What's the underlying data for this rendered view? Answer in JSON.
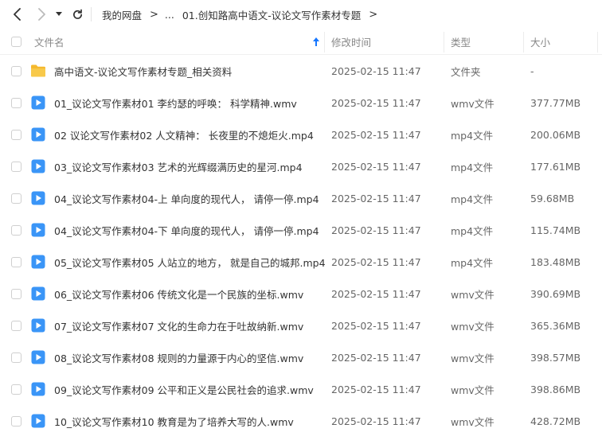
{
  "nav": {
    "back_icon": "chevron-left-icon",
    "forward_icon": "chevron-right-icon",
    "history_icon": "caret-down-icon",
    "refresh_icon": "refresh-icon"
  },
  "breadcrumb": {
    "root": "我的网盘",
    "ellipsis": "...",
    "current": "01.创知路高中语文-议论文写作素材专题"
  },
  "columns": {
    "name": "文件名",
    "modified": "修改时间",
    "type": "类型",
    "size": "大小",
    "sort_icon": "sort-up-arrow-icon"
  },
  "colors": {
    "accent": "#1677ff",
    "folder": "#f5b92e",
    "video": "#3a95f7"
  },
  "files": [
    {
      "name": "高中语文-议论文写作素材专题_相关资料",
      "modified": "2025-02-15 11:47",
      "type": "文件夹",
      "size": "-",
      "icon": "folder-icon"
    },
    {
      "name": "01_议论文写作素材01 李约瑟的呼唤： 科学精神.wmv",
      "modified": "2025-02-15 11:47",
      "type": "wmv文件",
      "size": "377.77MB",
      "icon": "video-file-icon"
    },
    {
      "name": "02 议论文写作素材02 人文精神： 长夜里的不熄炬火.mp4",
      "modified": "2025-02-15 11:47",
      "type": "mp4文件",
      "size": "200.06MB",
      "icon": "video-file-icon"
    },
    {
      "name": "03_议论文写作素材03 艺术的光辉缀满历史的星河.mp4",
      "modified": "2025-02-15 11:47",
      "type": "mp4文件",
      "size": "177.61MB",
      "icon": "video-file-icon"
    },
    {
      "name": "04_议论文写作素材04-上 单向度的现代人， 请停一停.mp4",
      "modified": "2025-02-15 11:47",
      "type": "mp4文件",
      "size": "59.68MB",
      "icon": "video-file-icon"
    },
    {
      "name": "04_议论文写作素材04-下 单向度的现代人， 请停一停.mp4",
      "modified": "2025-02-15 11:47",
      "type": "mp4文件",
      "size": "115.74MB",
      "icon": "video-file-icon"
    },
    {
      "name": "05_议论文写作素材05 人站立的地方， 就是自己的城邦.mp4",
      "modified": "2025-02-15 11:47",
      "type": "mp4文件",
      "size": "183.48MB",
      "icon": "video-file-icon"
    },
    {
      "name": "06_议论文写作素材06 传统文化是一个民族的坐标.wmv",
      "modified": "2025-02-15 11:47",
      "type": "wmv文件",
      "size": "390.69MB",
      "icon": "video-file-icon"
    },
    {
      "name": "07_议论文写作素材07 文化的生命力在于吐故纳新.wmv",
      "modified": "2025-02-15 11:47",
      "type": "wmv文件",
      "size": "365.36MB",
      "icon": "video-file-icon"
    },
    {
      "name": "08_议论文写作素材08 规则的力量源于内心的坚信.wmv",
      "modified": "2025-02-15 11:47",
      "type": "wmv文件",
      "size": "398.57MB",
      "icon": "video-file-icon"
    },
    {
      "name": "09_议论文写作素材09 公平和正义是公民社会的追求.wmv",
      "modified": "2025-02-15 11:47",
      "type": "wmv文件",
      "size": "398.86MB",
      "icon": "video-file-icon"
    },
    {
      "name": "10_议论文写作素材10 教育是为了培养大写的人.wmv",
      "modified": "2025-02-15 11:47",
      "type": "wmv文件",
      "size": "428.72MB",
      "icon": "video-file-icon"
    }
  ]
}
